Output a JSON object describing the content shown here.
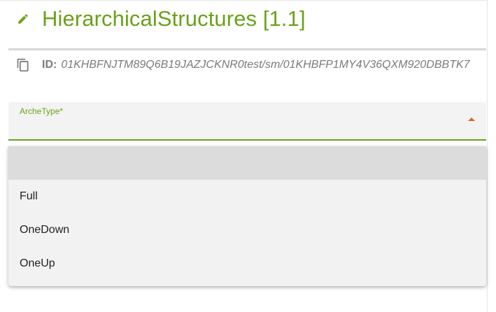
{
  "header": {
    "title": "HierarchicalStructures [1.1]",
    "edit_icon": "pencil-icon"
  },
  "id_row": {
    "copy_icon": "copy-icon",
    "label": "ID:",
    "value": "01KHBFNJTM89Q6B19JAZJCKNR0test/sm/01KHBFP1MY4V36QXM920DBBTK7"
  },
  "archetype_select": {
    "label": "ArcheType*",
    "value": "",
    "open": true,
    "options": [
      "",
      "Full",
      "OneDown",
      "OneUp"
    ],
    "highlighted_index": 0
  },
  "colors": {
    "accent": "#6aa219",
    "arrow": "#d86a1b",
    "field_bg": "#f3f3f3",
    "menu_bg": "#f2f2f2",
    "highlight_bg": "#dcdcdc"
  }
}
